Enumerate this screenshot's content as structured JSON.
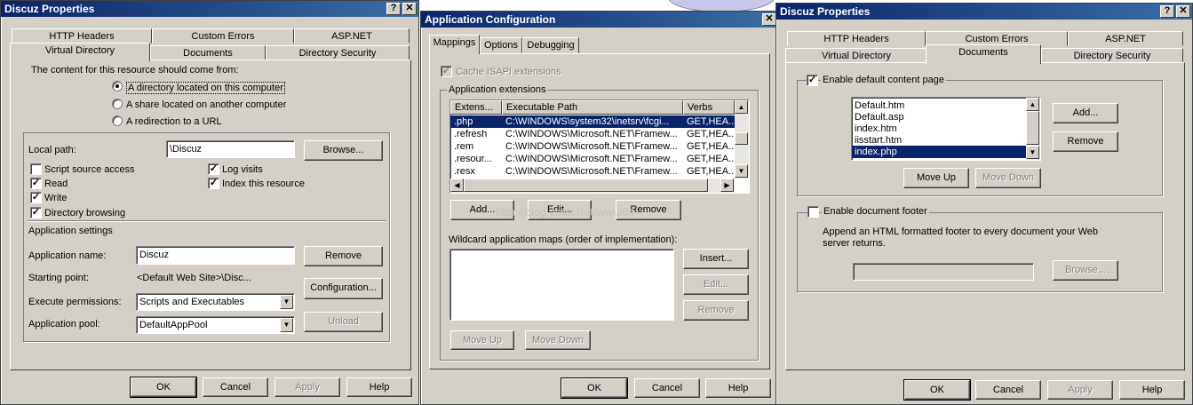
{
  "win1": {
    "title": "Discuz Properties",
    "tabs_back": [
      "HTTP Headers",
      "Custom Errors",
      "ASP.NET"
    ],
    "tabs_front": [
      "Virtual Directory",
      "Documents",
      "Directory Security"
    ],
    "source_prompt": "The content for this resource should come from:",
    "radios": [
      "A directory located on this computer",
      "A share located on another computer",
      "A redirection to a URL"
    ],
    "local_path_label": "Local path:",
    "local_path_value": "\\Discuz",
    "browse": "Browse...",
    "checks": {
      "script_source": "Script source access",
      "read": "Read",
      "write": "Write",
      "dir_browsing": "Directory browsing",
      "log_visits": "Log visits",
      "index": "Index this resource"
    },
    "app_settings": "Application settings",
    "app_name_label": "Application name:",
    "app_name_value": "Discuz",
    "remove": "Remove",
    "starting_point_label": "Starting point:",
    "starting_point_value": "<Default Web Site>\\Disc...",
    "configuration": "Configuration...",
    "exec_perm_label": "Execute permissions:",
    "exec_perm_value": "Scripts and Executables",
    "app_pool_label": "Application pool:",
    "app_pool_value": "DefaultAppPool",
    "unload": "Unload",
    "ok": "OK",
    "cancel": "Cancel",
    "apply": "Apply",
    "help": "Help"
  },
  "win2": {
    "title": "Application Configuration",
    "tabs": [
      "Mappings",
      "Options",
      "Debugging"
    ],
    "cache_isapi": "Cache ISAPI extensions",
    "app_extensions": "Application extensions",
    "columns": [
      "Extens...",
      "Executable Path",
      "Verbs"
    ],
    "rows": [
      [
        ".php",
        "C:\\WINDOWS\\system32\\inetsrv\\fcgi...",
        "GET,HEA..."
      ],
      [
        ".refresh",
        "C:\\WINDOWS\\Microsoft.NET\\Framew...",
        "GET,HEA..."
      ],
      [
        ".rem",
        "C:\\WINDOWS\\Microsoft.NET\\Framew...",
        "GET,HEA..."
      ],
      [
        ".resour...",
        "C:\\WINDOWS\\Microsoft.NET\\Framew...",
        "GET,HEA..."
      ],
      [
        ".resx",
        "C:\\WINDOWS\\Microsoft.NET\\Framew...",
        "GET,HEA..."
      ]
    ],
    "add": "Add...",
    "edit": "Edit...",
    "remove": "Remove",
    "wildcard_label": "Wildcard application maps (order of implementation):",
    "insert": "Insert...",
    "edit2": "Edit...",
    "remove2": "Remove",
    "move_up": "Move Up",
    "move_down": "Move Down",
    "watermark": "http://blog.csdn.net/wwui84",
    "ok": "OK",
    "cancel": "Cancel",
    "help": "Help"
  },
  "win3": {
    "title": "Discuz Properties",
    "tabs_back": [
      "HTTP Headers",
      "Custom Errors",
      "ASP.NET"
    ],
    "tabs_front": [
      "Virtual Directory",
      "Documents",
      "Directory Security"
    ],
    "enable_default": "Enable default content page",
    "docs": [
      "Default.htm",
      "Default.asp",
      "index.htm",
      "iisstart.htm",
      "index.php"
    ],
    "add": "Add...",
    "remove": "Remove",
    "move_up": "Move Up",
    "move_down": "Move Down",
    "enable_footer": "Enable document footer",
    "footer_desc_1": "Append an HTML formatted footer to every document your Web",
    "footer_desc_2": "server returns.",
    "browse": "Browse...",
    "ok": "OK",
    "cancel": "Cancel",
    "apply": "Apply",
    "help": "Help"
  }
}
